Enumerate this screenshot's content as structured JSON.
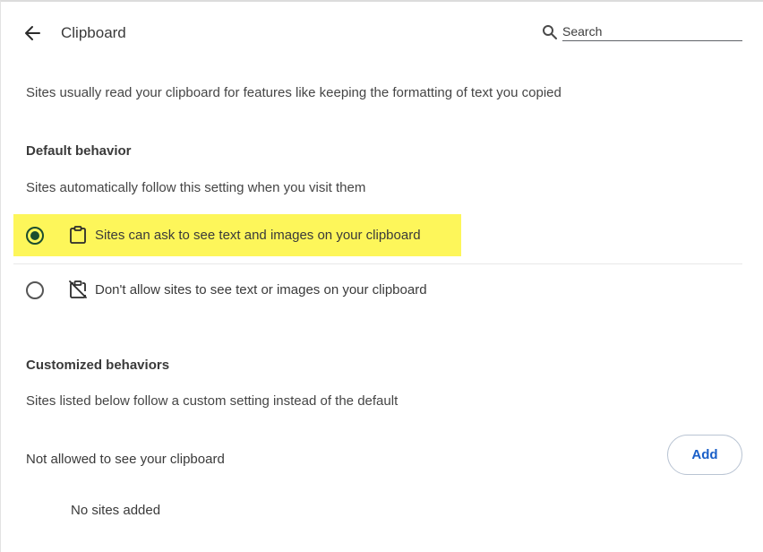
{
  "header": {
    "title": "Clipboard",
    "back_icon": "arrow-left-icon",
    "search_placeholder": "Search",
    "search_icon": "search-icon"
  },
  "description": "Sites usually read your clipboard for features like keeping the formatting of text you copied",
  "default_behavior": {
    "heading": "Default behavior",
    "subtext": "Sites automatically follow this setting when you visit them",
    "options": [
      {
        "label": "Sites can ask to see text and images on your clipboard",
        "icon": "clipboard-icon",
        "selected": true,
        "highlight_color": "#fdf65a"
      },
      {
        "label": "Don't allow sites to see text or images on your clipboard",
        "icon": "clipboard-off-icon",
        "selected": false
      }
    ]
  },
  "customized": {
    "heading": "Customized behaviors",
    "subtext": "Sites listed below follow a custom setting instead of the default",
    "not_allowed_label": "Not allowed to see your clipboard",
    "add_label": "Add",
    "empty_text": "No sites added"
  },
  "colors": {
    "accent": "#1a5fc8",
    "radio_selected": "#1b4d2f",
    "highlight": "#fdf65a"
  }
}
